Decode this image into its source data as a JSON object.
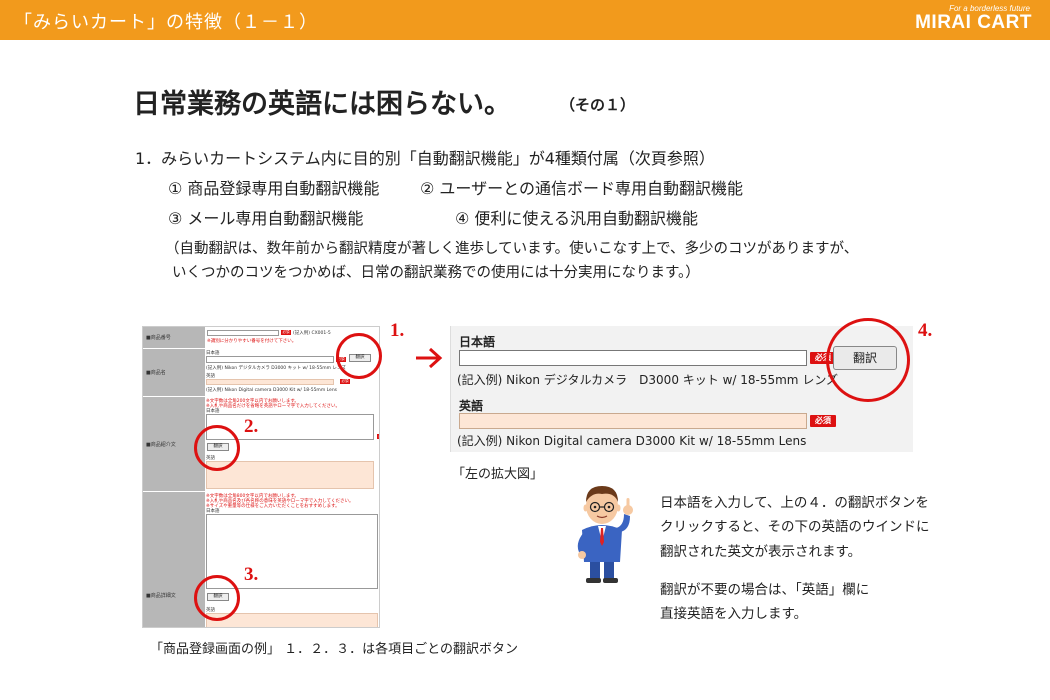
{
  "header": {
    "title": "「みらいカート」の特徴（１－１）",
    "logo_tagline": "For a borderless future",
    "logo_name": "MIRAI CART"
  },
  "heading": {
    "main": "日常業務の英語には困らない。",
    "sub": "（その１）"
  },
  "body": {
    "point1": "1．みらいカートシステム内に目的別「自動翻訳機能」が4種類付属（次頁参照）",
    "feature1": "① 商品登録専用自動翻訳機能",
    "feature2": "② ユーザーとの通信ボード専用自動翻訳機能",
    "feature3": "③ メール専用自動翻訳機能",
    "feature4": "④ 便利に使える汎用自動翻訳機能",
    "note1": "（自動翻訳は、数年前から翻訳精度が著しく進歩しています。使いこなす上で、多少のコツがありますが、",
    "note2": "いくつかのコツをつかめば、日常の翻訳業務での使用には十分実用になります。）"
  },
  "left_screenshot": {
    "labels": [
      "■商品番号",
      "■商品名",
      "■商品紹介文",
      "■商品詳細文"
    ],
    "product_no_example": "(記入例) CX001-5",
    "product_no_hint": "※識別に分かりやすい番号を付けて下さい。",
    "ja_label": "日本語",
    "en_label": "英語",
    "example_ja": "(記入例) Nikon デジタルカメラ D3000 キット w/ 18-55mm レンズ",
    "example_en": "(記入例) Nikon Digital camera D3000 Kit w/ 18-55mm Lens",
    "intro_hint1": "※文字数は全角200文字以内でお願いします。",
    "intro_hint2": "※入札や商品名だけを省略を英語やローマ字で入力してください。",
    "detail_hint1": "※文字数は全角800文字以内でお願いします。",
    "detail_hint2": "※入札や商品名及び各名称の意味を英語やローマ字で入力してください。",
    "detail_hint3": "※サイズや重量等の仕様をご入力いただくことをおすすめします。",
    "translate_btn": "翻訳",
    "required": "必須",
    "markers": [
      "1.",
      "2.",
      "3.",
      "4."
    ]
  },
  "zoom_panel": {
    "ja_label": "日本語",
    "en_label": "英語",
    "required": "必須",
    "translate_btn": "翻訳",
    "example_ja": "(記入例) Nikon デジタルカメラ　D3000 キット w/ 18-55mm レンズ",
    "example_en": "(記入例) Nikon Digital camera D3000 Kit w/ 18-55mm Lens"
  },
  "captions": {
    "zoom": "「左の拡大図」",
    "left": "「商品登録画面の例」 １．２．３．は各項目ごとの翻訳ボタン"
  },
  "explanation": {
    "line1": "日本語を入力して、上の４．の翻訳ボタンを",
    "line2": "クリックすると、その下の英語のウインドに",
    "line3": "翻訳された英文が表示されます。",
    "line4": "翻訳が不要の場合は、「英語」欄に",
    "line5": "直接英語を入力します。"
  },
  "colors": {
    "brand_orange": "#f29a1c",
    "accent_red": "#dd1111",
    "input_peach": "#fde6d6"
  }
}
